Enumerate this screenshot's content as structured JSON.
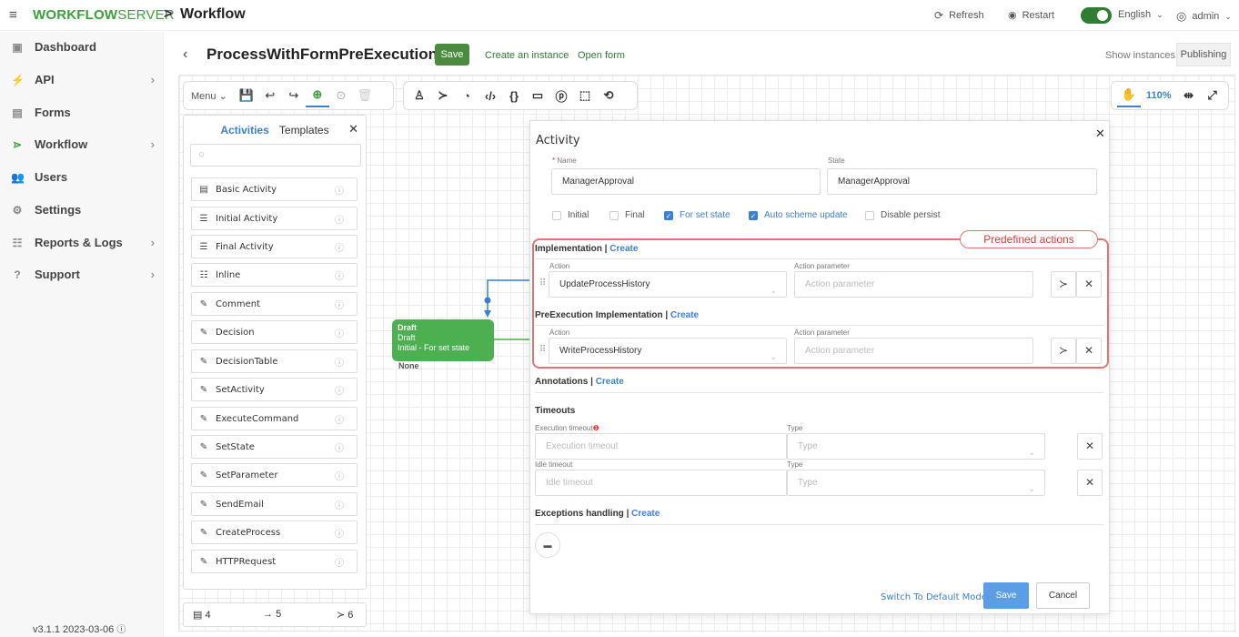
{
  "topbar": {
    "brand_bold": "WORKFLOW",
    "brand_light": "SERVER",
    "crumb_sep": ">",
    "crumb": "Workflow",
    "refresh": "Refresh",
    "restart": "Restart",
    "language": "English",
    "user": "admin"
  },
  "sidebar": {
    "items": [
      {
        "label": "Dashboard",
        "icon": "dashboard-icon"
      },
      {
        "label": "API",
        "icon": "api-icon"
      },
      {
        "label": "Forms",
        "icon": "forms-icon"
      },
      {
        "label": "Workflow",
        "icon": "workflow-icon"
      },
      {
        "label": "Users",
        "icon": "users-icon"
      },
      {
        "label": "Settings",
        "icon": "settings-icon"
      },
      {
        "label": "Reports & Logs",
        "icon": "reports-icon"
      },
      {
        "label": "Support",
        "icon": "support-icon"
      }
    ],
    "version": "v3.1.1 2023-03-06"
  },
  "header": {
    "title": "ProcessWithFormPreExecution",
    "save": "Save",
    "create_instance": "Create an instance",
    "open_form": "Open form",
    "show_instances": "Show instances",
    "publishing": "Publishing"
  },
  "toolbar": {
    "menu": "Menu",
    "zoom": "110%"
  },
  "activities_panel": {
    "tab_activities": "Activities",
    "tab_templates": "Templates",
    "items": [
      "Basic Activity",
      "Initial Activity",
      "Final Activity",
      "Inline",
      "Comment",
      "Decision",
      "DecisionTable",
      "SetActivity",
      "ExecuteCommand",
      "SetState",
      "SetParameter",
      "SendEmail",
      "CreateProcess",
      "HTTPRequest"
    ],
    "counts": {
      "activities": "4",
      "transitions": "5",
      "commands": "6"
    }
  },
  "draft_node": {
    "title": "Draft",
    "state": "Draft",
    "desc": "Initial - For set state",
    "below": "None"
  },
  "dialog": {
    "title": "Activity",
    "name_label": "Name",
    "name_value": "ManagerApproval",
    "state_label": "State",
    "state_value": "ManagerApproval",
    "checkboxes": [
      {
        "label": "Initial",
        "checked": false
      },
      {
        "label": "Final",
        "checked": false
      },
      {
        "label": "For set state",
        "checked": true
      },
      {
        "label": "Auto scheme update",
        "checked": true
      },
      {
        "label": "Disable persist",
        "checked": false
      }
    ],
    "predefined_pill": "Predefined actions",
    "implementation": "Implementation",
    "create": "Create",
    "action_label": "Action",
    "action_param_label": "Action parameter",
    "action_param_placeholder": "Action parameter",
    "impl_action": "UpdateProcessHistory",
    "preexec": "PreExecution Implementation",
    "preexec_action": "WriteProcessHistory",
    "annotations": "Annotations",
    "timeouts": "Timeouts",
    "exec_timeout_label": "Execution timeout",
    "exec_timeout_placeholder": "Execution timeout",
    "type_label": "Type",
    "type_placeholder": "Type",
    "idle_timeout_label": "Idle timeout",
    "idle_timeout_placeholder": "Idle timeout",
    "exceptions": "Exceptions handling",
    "switch_mode": "Switch To Default Mode",
    "save": "Save",
    "cancel": "Cancel"
  }
}
